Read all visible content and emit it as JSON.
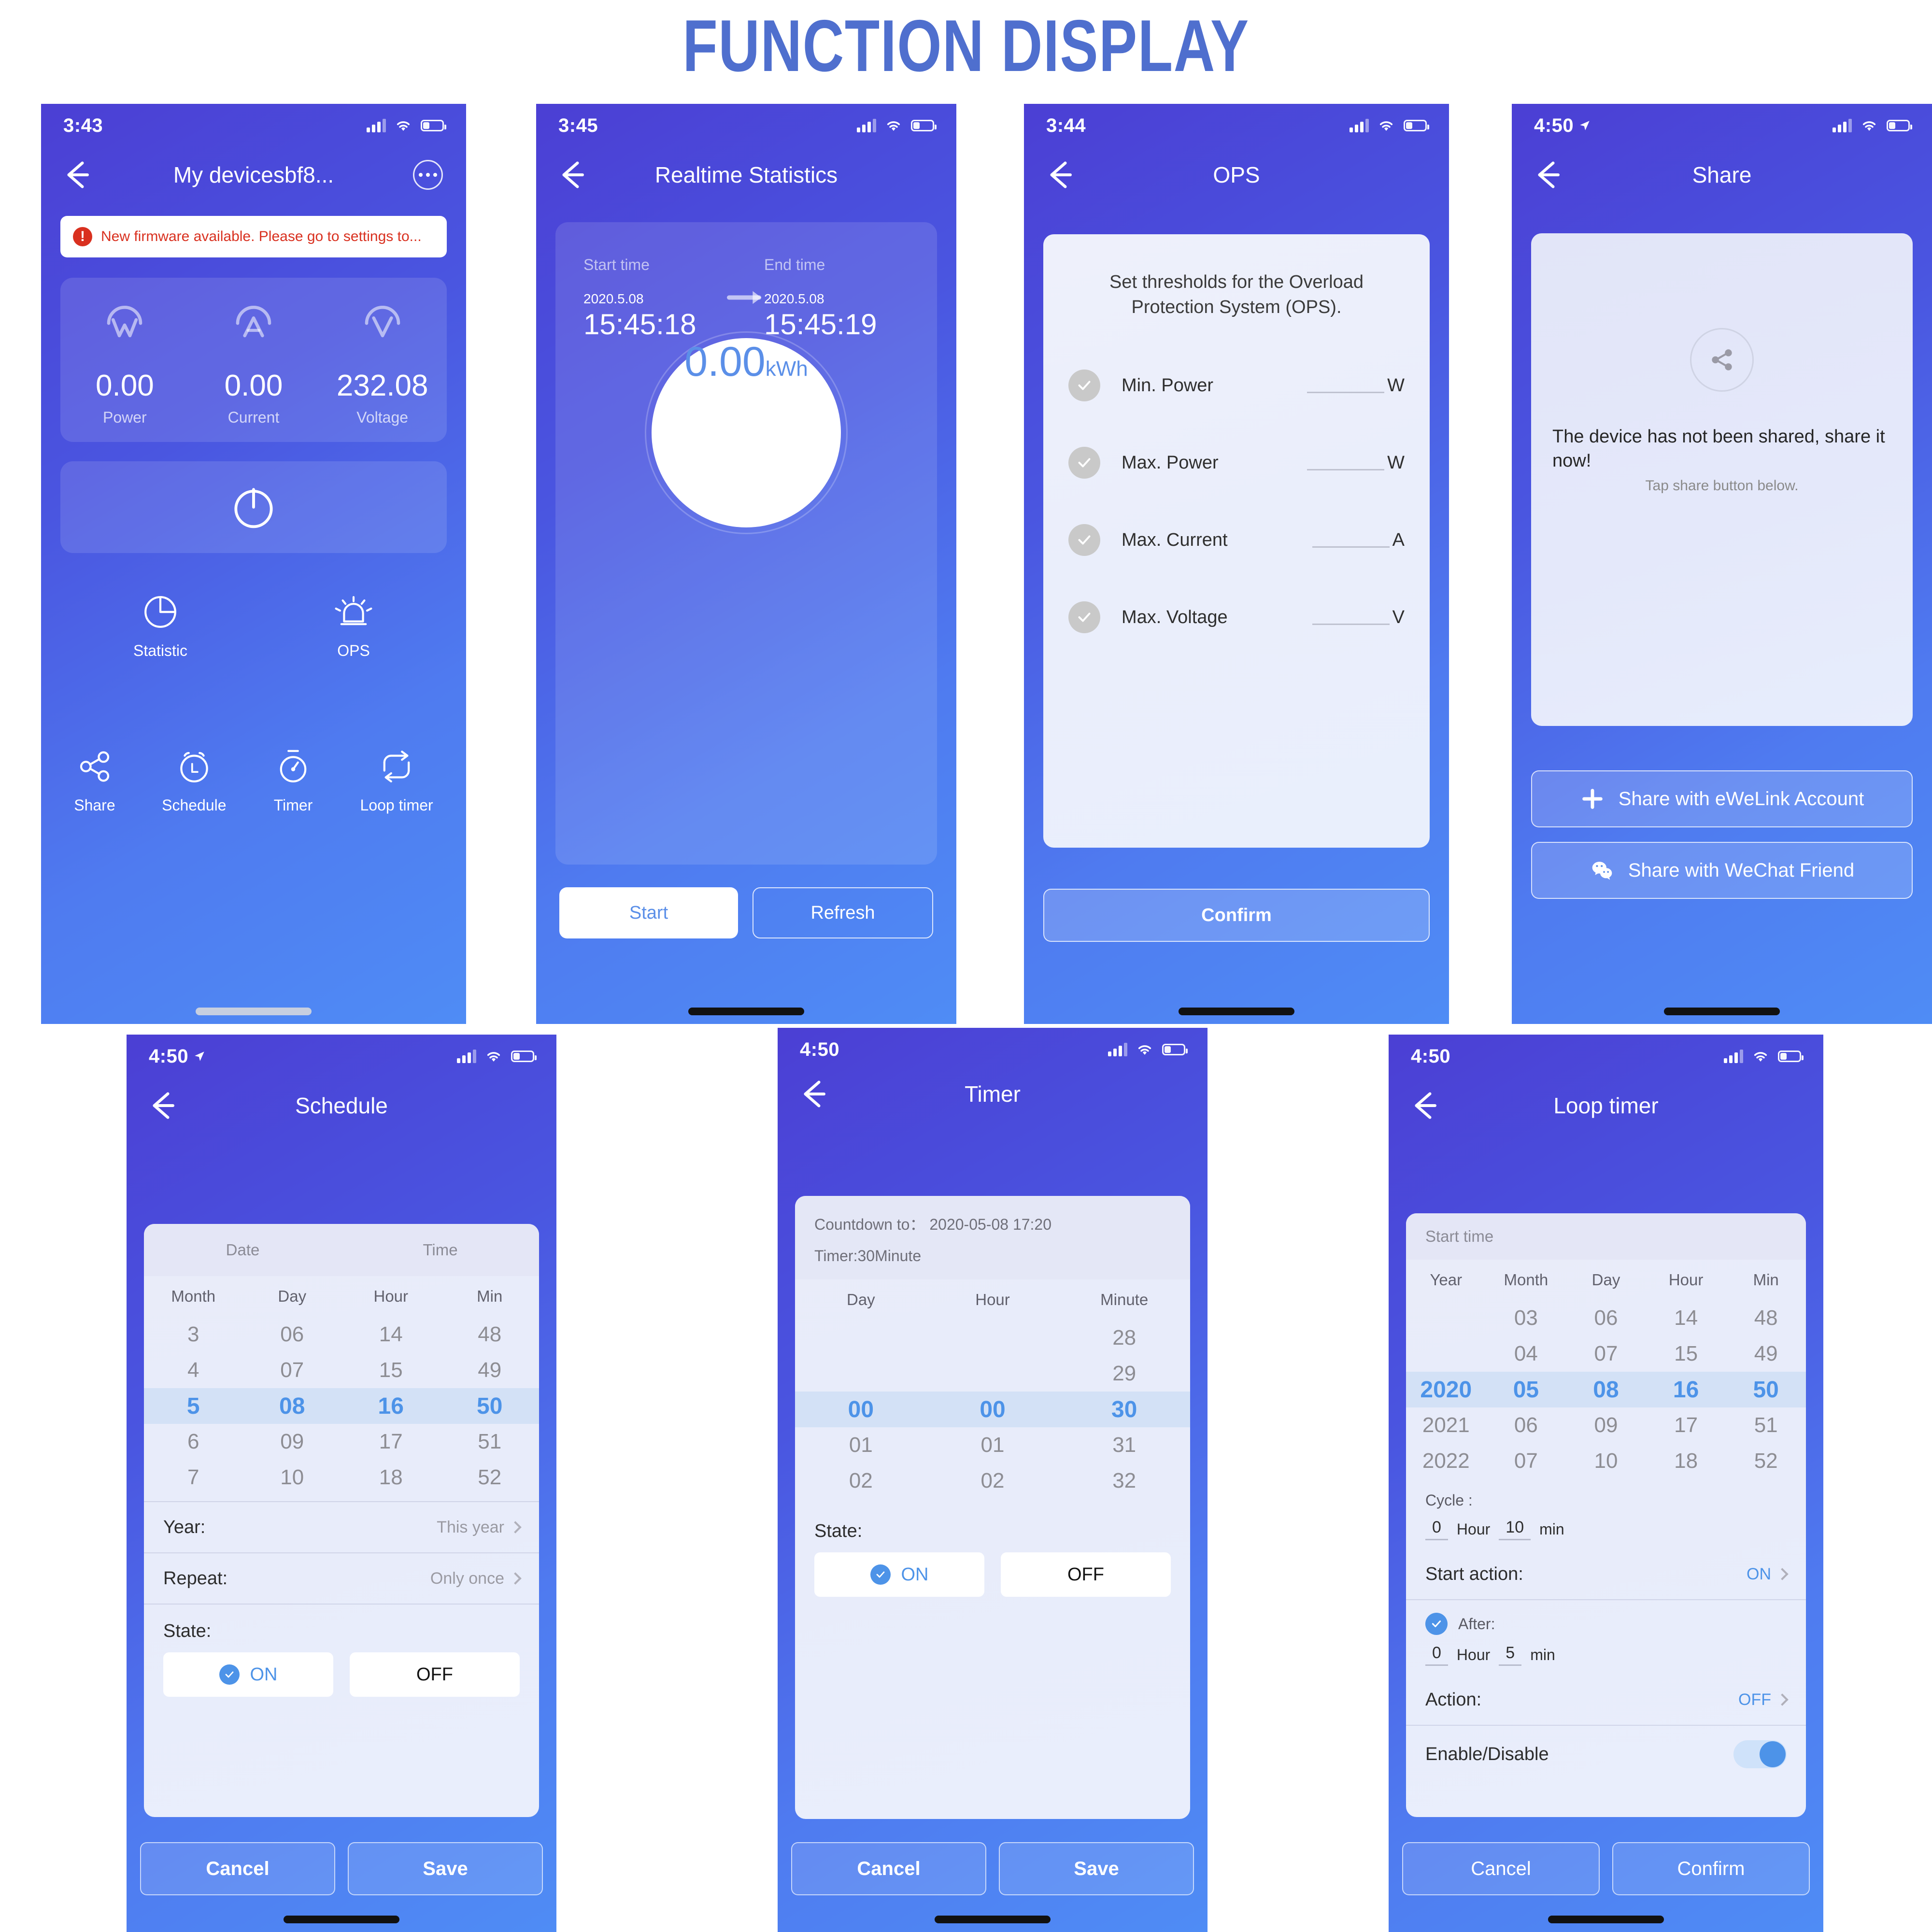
{
  "page_title": "FUNCTION DISPLAY",
  "accent": {
    "brand_blue": "#4f6fce",
    "pill_blue": "#4d93e8",
    "alert_red": "#d9301f"
  },
  "screens": {
    "device": {
      "status_time": "3:43",
      "title": "My devicesbf8...",
      "firmware_banner": "New firmware available. Please go to settings to...",
      "metrics": [
        {
          "icon": "watt-icon",
          "value": "0.00",
          "label": "Power"
        },
        {
          "icon": "ampere-icon",
          "value": "0.00",
          "label": "Current"
        },
        {
          "icon": "volt-icon",
          "value": "232.08",
          "label": "Voltage"
        }
      ],
      "power_button": "power-icon",
      "shortcuts_row1": [
        {
          "icon": "pie-chart-icon",
          "label": "Statistic"
        },
        {
          "icon": "siren-icon",
          "label": "OPS"
        }
      ],
      "shortcuts_row2": [
        {
          "icon": "share-icon",
          "label": "Share"
        },
        {
          "icon": "alarm-clock-icon",
          "label": "Schedule"
        },
        {
          "icon": "stopwatch-icon",
          "label": "Timer"
        },
        {
          "icon": "loop-icon",
          "label": "Loop timer"
        }
      ]
    },
    "realtime": {
      "status_time": "3:45",
      "title": "Realtime Statistics",
      "start_label": "Start time",
      "end_label": "End time",
      "start_date": "2020.5.08",
      "start_clock": "15:45:18",
      "end_date": "2020.5.08",
      "end_clock": "15:45:19",
      "energy_value": "0.00",
      "energy_unit": "kWh",
      "start_button": "Start",
      "refresh_button": "Refresh"
    },
    "ops": {
      "status_time": "3:44",
      "title": "OPS",
      "description": "Set thresholds for the Overload Protection System (OPS).",
      "rows": [
        {
          "name": "Min. Power",
          "unit": "W",
          "value": ""
        },
        {
          "name": "Max. Power",
          "unit": "W",
          "value": ""
        },
        {
          "name": "Max. Current",
          "unit": "A",
          "value": ""
        },
        {
          "name": "Max. Voltage",
          "unit": "V",
          "value": ""
        }
      ],
      "confirm_button": "Confirm"
    },
    "share": {
      "status_time": "4:50",
      "title": "Share",
      "message": "The device has not been shared, share it now!",
      "hint": "Tap share button below.",
      "ewelink_button": "Share with eWeLink Account",
      "wechat_button": "Share with WeChat Friend"
    },
    "schedule": {
      "status_time": "4:50",
      "title": "Schedule",
      "group_headers": [
        "Date",
        "Time"
      ],
      "columns": [
        "Month",
        "Day",
        "Hour",
        "Min"
      ],
      "rows": [
        [
          "3",
          "06",
          "14",
          "48"
        ],
        [
          "4",
          "07",
          "15",
          "49"
        ],
        [
          "5",
          "08",
          "16",
          "50"
        ],
        [
          "6",
          "09",
          "17",
          "51"
        ],
        [
          "7",
          "10",
          "18",
          "52"
        ]
      ],
      "selected_index": 2,
      "year_label": "Year:",
      "year_value": "This year",
      "repeat_label": "Repeat:",
      "repeat_value": "Only once",
      "state_label": "State:",
      "on_label": "ON",
      "off_label": "OFF",
      "cancel_button": "Cancel",
      "save_button": "Save"
    },
    "timer": {
      "status_time": "4:50",
      "title": "Timer",
      "countdown_line": "Countdown to： 2020-05-08 17:20",
      "timer_line": "Timer:30Minute",
      "columns": [
        "Day",
        "Hour",
        "Minute"
      ],
      "rows": [
        [
          "",
          "",
          "28"
        ],
        [
          "",
          "",
          "29"
        ],
        [
          "00",
          "00",
          "30"
        ],
        [
          "01",
          "01",
          "31"
        ],
        [
          "02",
          "02",
          "32"
        ]
      ],
      "selected_index": 2,
      "state_label": "State:",
      "on_label": "ON",
      "off_label": "OFF",
      "cancel_button": "Cancel",
      "save_button": "Save"
    },
    "loop": {
      "status_time": "4:50",
      "title": "Loop timer",
      "start_time_label": "Start time",
      "columns": [
        "Year",
        "Month",
        "Day",
        "Hour",
        "Min"
      ],
      "rows": [
        [
          "",
          "03",
          "06",
          "14",
          "48"
        ],
        [
          "",
          "04",
          "07",
          "15",
          "49"
        ],
        [
          "2020",
          "05",
          "08",
          "16",
          "50"
        ],
        [
          "2021",
          "06",
          "09",
          "17",
          "51"
        ],
        [
          "2022",
          "07",
          "10",
          "18",
          "52"
        ]
      ],
      "selected_index": 2,
      "cycle_label": "Cycle :",
      "cycle_hour": "0",
      "cycle_hour_unit": "Hour",
      "cycle_min": "10",
      "cycle_min_unit": "min",
      "start_action_label": "Start action:",
      "start_action_value": "ON",
      "after_label": "After:",
      "after_hour": "0",
      "after_hour_unit": "Hour",
      "after_min": "5",
      "after_min_unit": "min",
      "action_label": "Action:",
      "action_value": "OFF",
      "enable_label": "Enable/Disable",
      "enable_on": true,
      "cancel_button": "Cancel",
      "confirm_button": "Confirm"
    }
  }
}
